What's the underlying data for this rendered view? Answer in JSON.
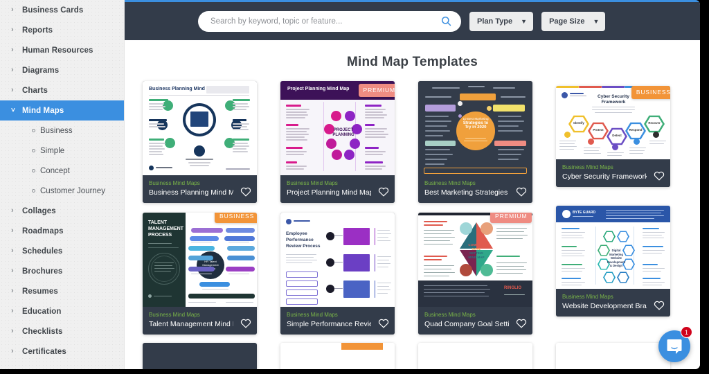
{
  "theme": {
    "accent": "#3b8fe0",
    "topbar_bg": "#333c4a",
    "card_bg": "#333c4a",
    "category_green": "#7ab648",
    "badge_premium": "#ef8c82",
    "badge_business": "#f29438",
    "sidebar_bg": "#f0f0f0"
  },
  "sidebar": {
    "items": [
      {
        "label": "Business Cards",
        "icon": "chevron-right-icon",
        "active": false,
        "expanded": false
      },
      {
        "label": "Reports",
        "icon": "chevron-right-icon",
        "active": false,
        "expanded": false
      },
      {
        "label": "Human Resources",
        "icon": "chevron-right-icon",
        "active": false,
        "expanded": false
      },
      {
        "label": "Diagrams",
        "icon": "chevron-right-icon",
        "active": false,
        "expanded": false
      },
      {
        "label": "Charts",
        "icon": "chevron-right-icon",
        "active": false,
        "expanded": false
      },
      {
        "label": "Mind Maps",
        "icon": "chevron-down-icon",
        "active": true,
        "expanded": true
      },
      {
        "label": "Collages",
        "icon": "chevron-right-icon",
        "active": false,
        "expanded": false
      },
      {
        "label": "Roadmaps",
        "icon": "chevron-right-icon",
        "active": false,
        "expanded": false
      },
      {
        "label": "Schedules",
        "icon": "chevron-right-icon",
        "active": false,
        "expanded": false
      },
      {
        "label": "Brochures",
        "icon": "chevron-right-icon",
        "active": false,
        "expanded": false
      },
      {
        "label": "Resumes",
        "icon": "chevron-right-icon",
        "active": false,
        "expanded": false
      },
      {
        "label": "Education",
        "icon": "chevron-right-icon",
        "active": false,
        "expanded": false
      },
      {
        "label": "Checklists",
        "icon": "chevron-right-icon",
        "active": false,
        "expanded": false
      },
      {
        "label": "Certificates",
        "icon": "chevron-right-icon",
        "active": false,
        "expanded": false
      }
    ],
    "subitems": [
      {
        "label": "Business"
      },
      {
        "label": "Simple"
      },
      {
        "label": "Concept"
      },
      {
        "label": "Customer Journey"
      }
    ]
  },
  "topbar": {
    "search": {
      "placeholder": "Search by keyword, topic or feature...",
      "value": "",
      "icon": "search-icon"
    },
    "filters": [
      {
        "label": "Plan Type",
        "icon": "chevron-down-icon"
      },
      {
        "label": "Page Size",
        "icon": "chevron-down-icon"
      }
    ]
  },
  "main": {
    "page_title": "Mind Map Templates",
    "cards": [
      {
        "category": "Business Mind Maps",
        "title": "Business Planning Mind Map",
        "badge": null,
        "favorite_icon": "heart-outline-icon",
        "thumb_heading": "Business Planning Mind Map",
        "thumb_style": "light-hub-spoke-green"
      },
      {
        "category": "Business Mind Maps",
        "title": "Project Planning Mind Map",
        "badge": "PREMIUM",
        "badge_type": "premium",
        "favorite_icon": "heart-outline-icon",
        "thumb_heading": "Project Planning Mind Map",
        "thumb_center": "PROJECT PLANNING",
        "thumb_style": "purple-ring"
      },
      {
        "category": "Business Mind Maps",
        "title": "Best Marketing Strategies Min...",
        "badge": null,
        "favorite_icon": "heart-outline-icon",
        "thumb_center": "10 Best Marketing Strategies to Try in 2020",
        "thumb_style": "dark-orange-circle"
      },
      {
        "category": "Business Mind Maps",
        "title": "Cyber Security Framework Min...",
        "badge": "BUSINESS",
        "badge_type": "business",
        "favorite_icon": "heart-outline-icon",
        "thumb_heading": "Cyber Security Framework",
        "thumb_nodes": [
          "Identify",
          "Protect",
          "Detect",
          "Respond",
          "Recover"
        ],
        "thumb_style": "hexagons"
      },
      {
        "category": "Business Mind Maps",
        "title": "Talent Management Mind Map",
        "badge": "BUSINESS",
        "badge_type": "business",
        "favorite_icon": "heart-outline-icon",
        "thumb_heading": "TALENT MANAGEMENT PROCESS",
        "thumb_style": "dark-left-panel"
      },
      {
        "category": "Business Mind Maps",
        "title": "Simple Performance Review M...",
        "badge": null,
        "favorite_icon": "heart-outline-icon",
        "thumb_heading": "Employee Performance Review Process",
        "thumb_style": "white-purple-blocks"
      },
      {
        "category": "Business Mind Maps",
        "title": "Quad Company Goal Setting ...",
        "badge": "PREMIUM",
        "badge_type": "premium",
        "favorite_icon": "heart-outline-icon",
        "thumb_center": "COMPANY GOAL SETTING MIND MAP",
        "thumb_style": "quad-petals"
      },
      {
        "category": "Business Mind Maps",
        "title": "Website Development Brainst...",
        "badge": null,
        "favorite_icon": "heart-outline-icon",
        "thumb_center": "Digital Marketing Website Development & Design",
        "thumb_style": "blue-hex-web"
      }
    ]
  },
  "chat": {
    "icon": "chat-bubble-icon",
    "unread_count": "1"
  }
}
